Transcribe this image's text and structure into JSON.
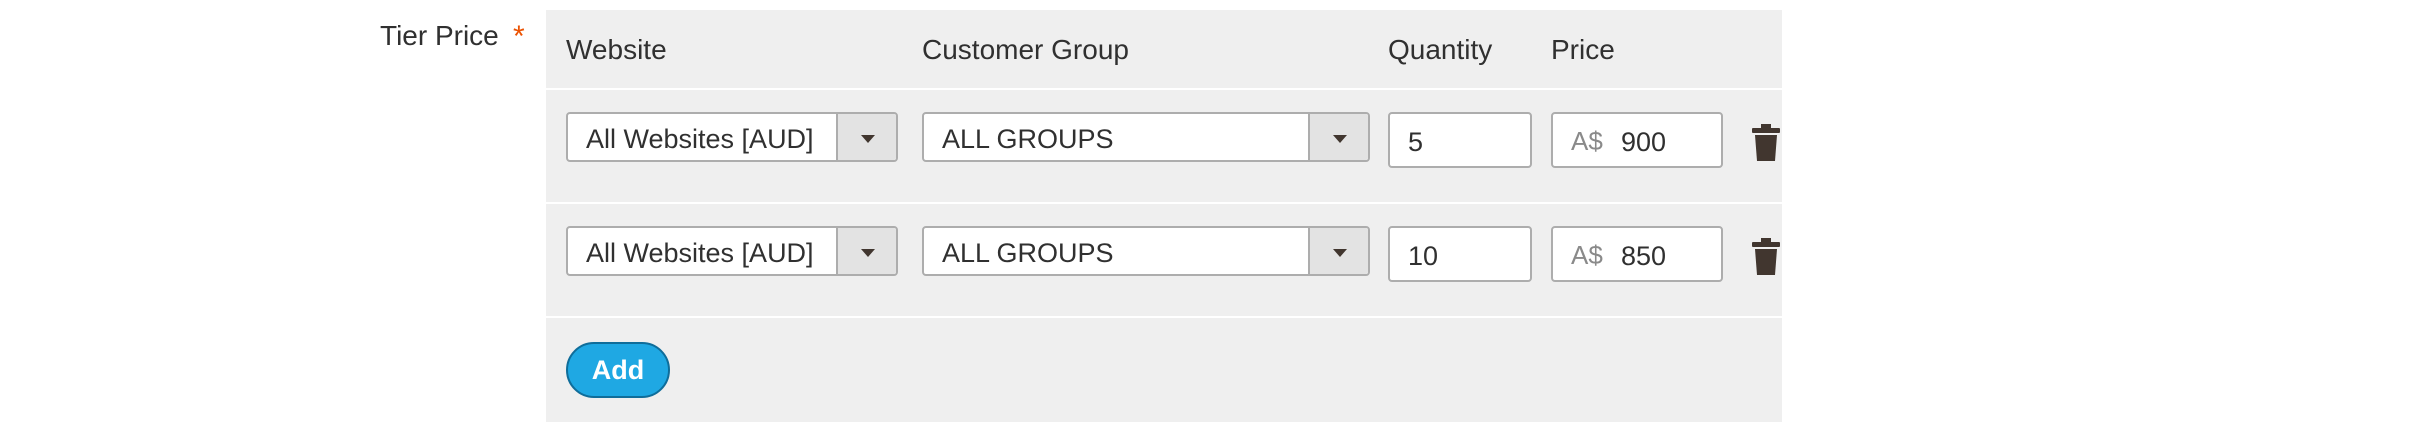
{
  "field": {
    "label": "Tier Price",
    "required_mark": "*"
  },
  "table": {
    "headers": {
      "website": "Website",
      "customer_group": "Customer Group",
      "quantity": "Quantity",
      "price": "Price"
    },
    "rows": [
      {
        "website": "All Websites [AUD]",
        "customer_group": "ALL GROUPS",
        "quantity": "5",
        "currency": "A$",
        "price": "900"
      },
      {
        "website": "All Websites [AUD]",
        "customer_group": "ALL GROUPS",
        "quantity": "10",
        "currency": "A$",
        "price": "850"
      }
    ],
    "add_label": "Add"
  },
  "icons": {
    "select_arrow": "chevron-down-icon",
    "delete": "trash-icon"
  },
  "colors": {
    "required": "#eb5202",
    "add_button": "#1fa8e3",
    "table_background": "#efefef"
  }
}
